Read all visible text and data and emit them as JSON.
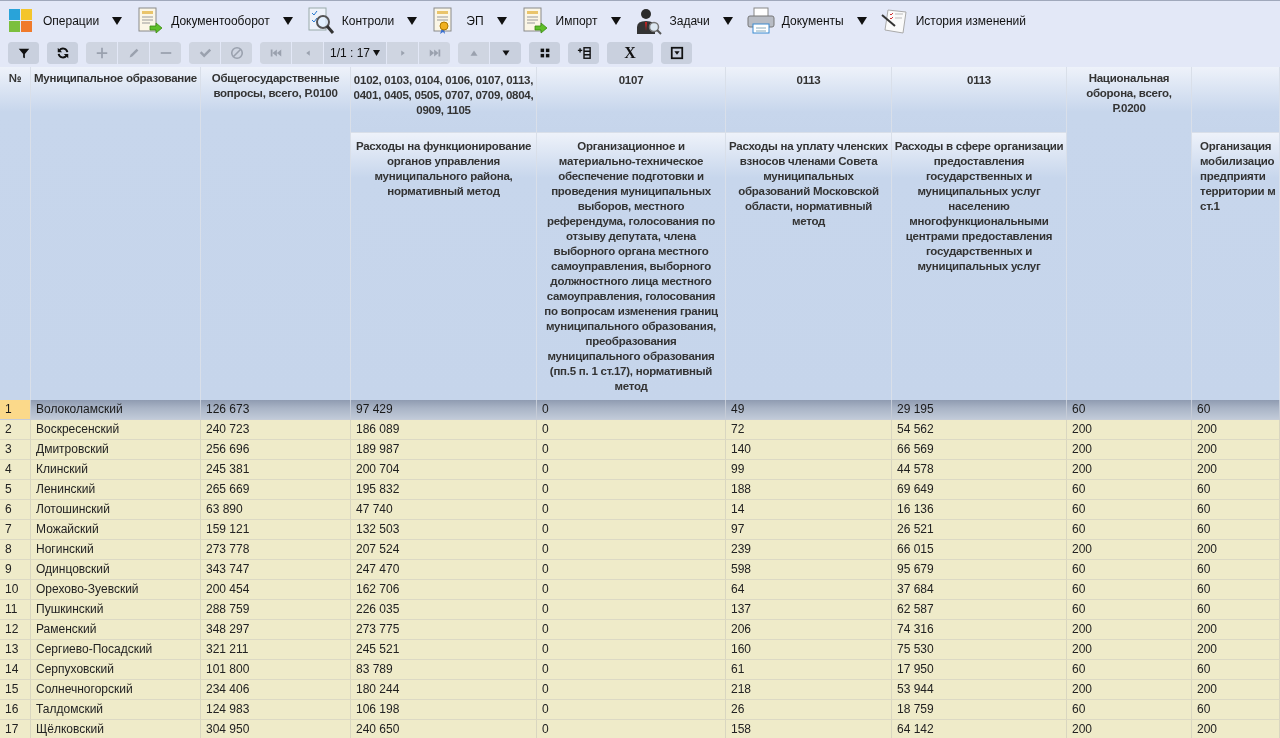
{
  "menu": [
    {
      "label": "Операции",
      "dropdown": true
    },
    {
      "label": "Документооборот",
      "dropdown": true
    },
    {
      "label": "Контроли",
      "dropdown": true
    },
    {
      "label": "ЭП",
      "dropdown": true
    },
    {
      "label": "Импорт",
      "dropdown": true
    },
    {
      "label": "Задачи",
      "dropdown": true
    },
    {
      "label": "Документы",
      "dropdown": true
    },
    {
      "label": "История изменений",
      "dropdown": false
    }
  ],
  "toolbar": [
    [
      {
        "kind": "button",
        "disabled": false
      }
    ],
    [
      {
        "kind": "button",
        "disabled": false
      }
    ],
    [
      {
        "kind": "button",
        "disabled": true
      },
      {
        "kind": "button",
        "disabled": true
      },
      {
        "kind": "button",
        "disabled": true
      }
    ],
    [
      {
        "kind": "button",
        "disabled": true
      },
      {
        "kind": "button",
        "disabled": true
      }
    ],
    [
      {
        "kind": "button",
        "disabled": true
      },
      {
        "kind": "button",
        "disabled": true
      },
      {
        "kind": "pager",
        "label": "1/1 : 17",
        "disabled": false
      },
      {
        "kind": "button",
        "disabled": true
      },
      {
        "kind": "button",
        "disabled": true
      }
    ],
    [
      {
        "kind": "button",
        "disabled": true
      },
      {
        "kind": "button",
        "disabled": false
      }
    ],
    [
      {
        "kind": "button",
        "disabled": false
      }
    ],
    [
      {
        "kind": "button",
        "disabled": false
      }
    ],
    [
      {
        "kind": "text",
        "label": "X",
        "disabled": false
      }
    ],
    [
      {
        "kind": "button",
        "disabled": false
      }
    ]
  ],
  "table": {
    "columns": [
      {
        "kind": "total",
        "heading": "№"
      },
      {
        "kind": "total",
        "heading": "Муниципальное образование"
      },
      {
        "kind": "total",
        "heading": "Общегосударственные вопросы, всего, Р.0100"
      },
      {
        "kind": "coded",
        "code": "0102, 0103, 0104, 0106, 0107, 0113, 0401, 0405, 0505, 0707, 0709, 0804, 0909, 1105",
        "heading": "Расходы на функционирование органов управления муниципального района, нормативный метод"
      },
      {
        "kind": "coded",
        "code": "0107",
        "heading": "Организационное и материально-техническое обеспечение подготовки и проведения муниципальных выборов, местного референдума, голосования по отзыву депутата, члена выборного органа местного самоуправления, выборного должностного лица местного самоуправления, голосования по вопросам изменения границ муниципального образования, преобразования муниципального образования (пп.5 п. 1 ст.17), нормативный метод"
      },
      {
        "kind": "coded",
        "code": "0113",
        "heading": "Расходы на уплату членских взносов членами Совета муниципальных образований Московской области, нормативный метод"
      },
      {
        "kind": "coded",
        "code": "0113",
        "heading": "Расходы в сфере организации предоставления государственных и муниципальных услуг населению многофункциональными центрами предоставления государственных и муниципальных услуг"
      },
      {
        "kind": "total",
        "heading": "Национальная оборона, всего, Р.0200"
      },
      {
        "kind": "sub",
        "heading": "Организация\nмобилизацио\nпредприяти\nтерритории м\nст.1"
      }
    ],
    "rows": [
      {
        "selected": true,
        "cells": [
          "1",
          "Волоколамский",
          "126 673",
          "97 429",
          "0",
          "49",
          "29 195",
          "60",
          "60"
        ]
      },
      {
        "selected": false,
        "cells": [
          "2",
          "Воскресенский",
          "240 723",
          "186 089",
          "0",
          "72",
          "54 562",
          "200",
          "200"
        ]
      },
      {
        "selected": false,
        "cells": [
          "3",
          "Дмитровский",
          "256 696",
          "189 987",
          "0",
          "140",
          "66 569",
          "200",
          "200"
        ]
      },
      {
        "selected": false,
        "cells": [
          "4",
          "Клинский",
          "245 381",
          "200 704",
          "0",
          "99",
          "44 578",
          "200",
          "200"
        ]
      },
      {
        "selected": false,
        "cells": [
          "5",
          "Ленинский",
          "265 669",
          "195 832",
          "0",
          "188",
          "69 649",
          "60",
          "60"
        ]
      },
      {
        "selected": false,
        "cells": [
          "6",
          "Лотошинский",
          "63 890",
          "47 740",
          "0",
          "14",
          "16 136",
          "60",
          "60"
        ]
      },
      {
        "selected": false,
        "cells": [
          "7",
          "Можайский",
          "159 121",
          "132 503",
          "0",
          "97",
          "26 521",
          "60",
          "60"
        ]
      },
      {
        "selected": false,
        "cells": [
          "8",
          "Ногинский",
          "273 778",
          "207 524",
          "0",
          "239",
          "66 015",
          "200",
          "200"
        ]
      },
      {
        "selected": false,
        "cells": [
          "9",
          "Одинцовский",
          "343 747",
          "247 470",
          "0",
          "598",
          "95 679",
          "60",
          "60"
        ]
      },
      {
        "selected": false,
        "cells": [
          "10",
          "Орехово-Зуевский",
          "200 454",
          "162 706",
          "0",
          "64",
          "37 684",
          "60",
          "60"
        ]
      },
      {
        "selected": false,
        "cells": [
          "11",
          "Пушкинский",
          "288 759",
          "226 035",
          "0",
          "137",
          "62 587",
          "60",
          "60"
        ]
      },
      {
        "selected": false,
        "cells": [
          "12",
          "Раменский",
          "348 297",
          "273 775",
          "0",
          "206",
          "74 316",
          "200",
          "200"
        ]
      },
      {
        "selected": false,
        "cells": [
          "13",
          "Сергиево-Посадский",
          "321 211",
          "245 521",
          "0",
          "160",
          "75 530",
          "200",
          "200"
        ]
      },
      {
        "selected": false,
        "cells": [
          "14",
          "Серпуховский",
          "101 800",
          "83 789",
          "0",
          "61",
          "17 950",
          "60",
          "60"
        ]
      },
      {
        "selected": false,
        "cells": [
          "15",
          "Солнечногорский",
          "234 406",
          "180 244",
          "0",
          "218",
          "53 944",
          "200",
          "200"
        ]
      },
      {
        "selected": false,
        "cells": [
          "16",
          "Талдомский",
          "124 983",
          "106 198",
          "0",
          "26",
          "18 759",
          "60",
          "60"
        ]
      },
      {
        "selected": false,
        "cells": [
          "17",
          "Щёлковский",
          "304 950",
          "240 650",
          "0",
          "158",
          "64 142",
          "200",
          "200"
        ]
      }
    ]
  }
}
